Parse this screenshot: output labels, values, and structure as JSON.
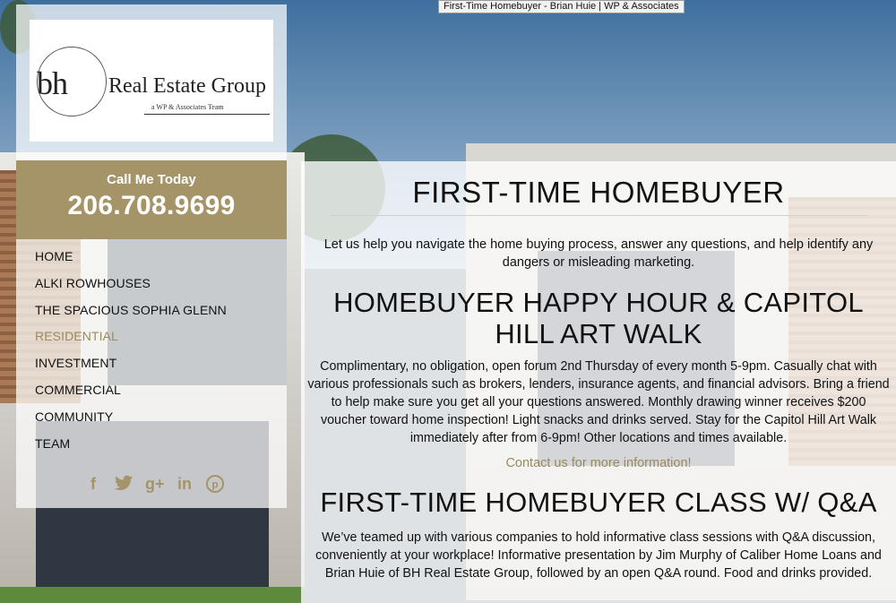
{
  "window": {
    "title_tooltip": "First-Time Homebuyer - Brian Huie | WP & Associates"
  },
  "logo": {
    "monogram": "bh",
    "name": "Real Estate Group",
    "tagline": "a WP & Associates Team"
  },
  "call": {
    "label": "Call Me Today",
    "phone": "206.708.9699"
  },
  "nav": {
    "items": [
      {
        "label": "HOME"
      },
      {
        "label": "ALKI ROWHOUSES"
      },
      {
        "label": "THE SPACIOUS SOPHIA GLENN"
      },
      {
        "label": "RESIDENTIAL",
        "active": true
      },
      {
        "label": "INVESTMENT"
      },
      {
        "label": "COMMERCIAL"
      },
      {
        "label": "COMMUNITY"
      },
      {
        "label": "TEAM"
      }
    ]
  },
  "social": {
    "icons": [
      "facebook-icon",
      "twitter-icon",
      "google-plus-icon",
      "linkedin-icon",
      "pinterest-icon"
    ],
    "glyphs": [
      "f",
      "🐦",
      "g+",
      "in",
      "℗"
    ],
    "color": "#a59468"
  },
  "main": {
    "title": "FIRST-TIME HOMEBUYER",
    "intro": "Let us help you navigate the home buying process, answer any questions, and help identify any dangers or misleading marketing.",
    "section1": {
      "heading": "HOMEBUYER HAPPY HOUR & CAPITOL HILL ART WALK",
      "body": "Complimentary, no obligation, open forum 2nd Thursday of every month 5-9pm. Casually chat with various professionals such as brokers, lenders, insurance agents, and financial advisors. Bring a friend to help make sure you get all your questions answered. Monthly drawing winner receives $200 voucher toward home inspection! Light snacks and drinks served. Stay for the Capitol Hill Art Walk immediately after from 6-9pm! Other locations and times available.",
      "link": "Contact us for more information!"
    },
    "section2": {
      "heading": "FIRST-TIME HOMEBUYER CLASS W/ Q&A",
      "body": "We’ve teamed up with various companies to hold informative class sessions with Q&A discussion, conveniently at your workplace! Informative presentation by Jim Murphy of Caliber Home Loans and Brian Huie of BH Real Estate Group, followed by an open Q&A round. Food and drinks provided."
    }
  },
  "colors": {
    "accent": "#a59468",
    "active_nav": "#9b8a5e"
  }
}
